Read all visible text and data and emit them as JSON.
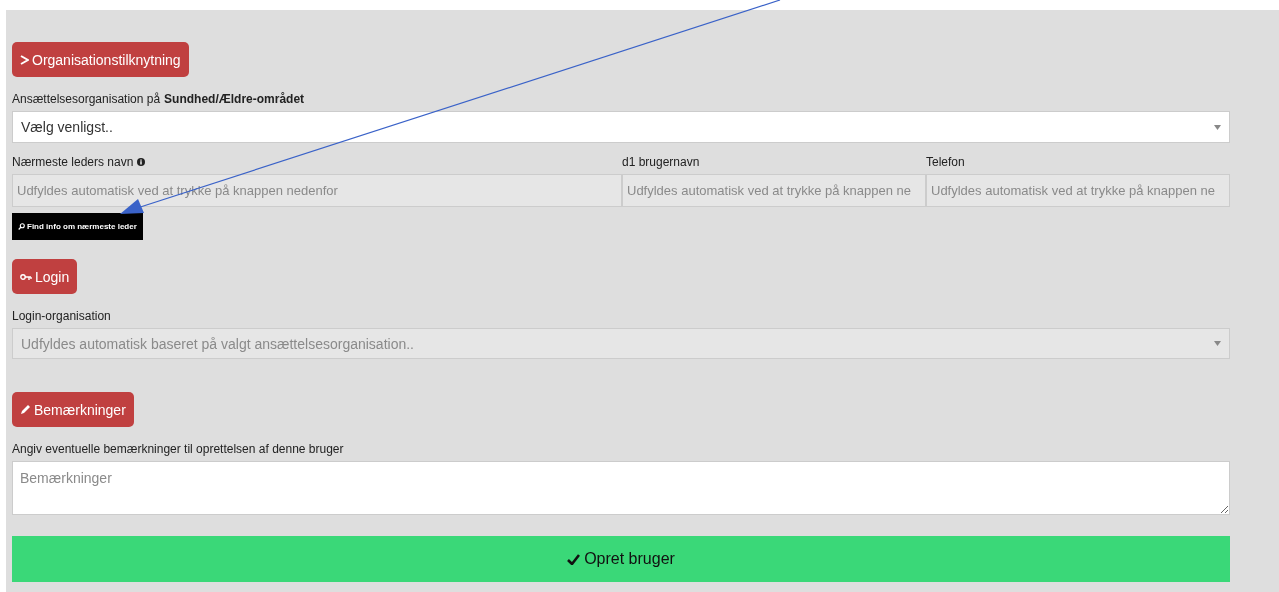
{
  "organisation": {
    "heading": {
      "label": "Organisationstilknytning"
    },
    "employment_label": "Ansættelsesorganisation på **Sundhed/Ældre-området**",
    "employment_select": {
      "value": "Vælg venligst..",
      "disabled": false
    },
    "fields": [
      {
        "label": "Nærmeste leders navn",
        "info": true,
        "placeholder": "Udfyldes automatisk ved at trykke på knappen nedenfor"
      },
      {
        "label": "d1 brugernavn",
        "info": false,
        "placeholder": "Udfyldes automatisk ved at trykke på knappen ne"
      },
      {
        "label": "Telefon",
        "info": false,
        "placeholder": "Udfyldes automatisk ved at trykke på knappen ne"
      }
    ],
    "find_button": "Find info om nærmeste leder"
  },
  "login": {
    "heading": {
      "label": "Login"
    },
    "label": "Login-organisation",
    "select": {
      "placeholder": "Udfyldes automatisk baseret på valgt ansættelsesorganisation..",
      "disabled": true
    }
  },
  "remarks": {
    "heading": {
      "label": "Bemærkninger"
    },
    "label": "Angiv eventuelle bemærkninger til oprettelsen af denne bruger",
    "placeholder": "Bemærkninger"
  },
  "submit": "Opret bruger"
}
